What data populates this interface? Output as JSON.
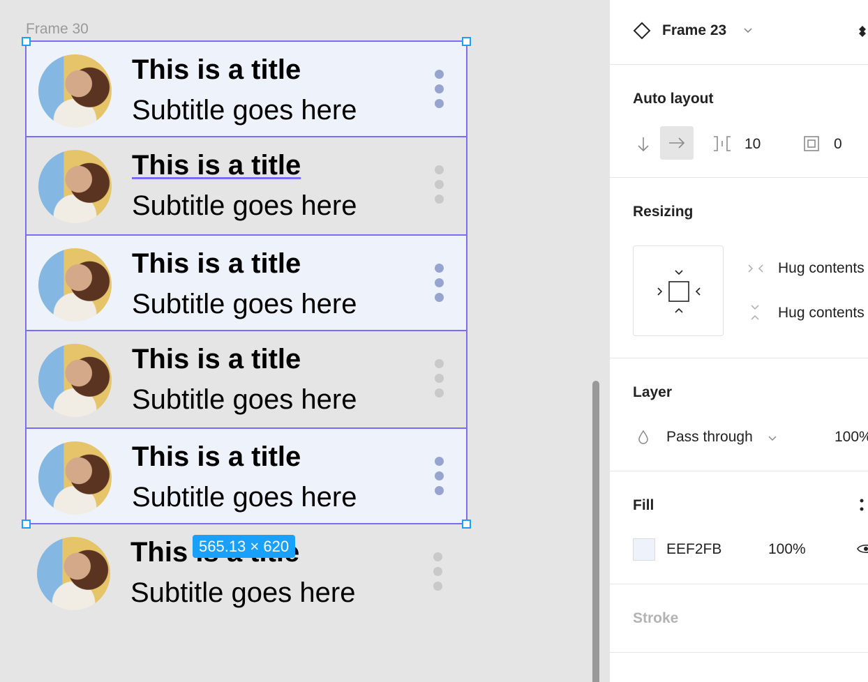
{
  "canvas": {
    "frame_label": "Frame 30",
    "size_badge": "565.13 × 620",
    "rows": [
      {
        "title": "This is a title",
        "subtitle": "Subtitle goes here"
      },
      {
        "title": "This is a title",
        "subtitle": "Subtitle goes here"
      },
      {
        "title": "This is a title",
        "subtitle": "Subtitle goes here"
      },
      {
        "title": "This is a title",
        "subtitle": "Subtitle goes here"
      },
      {
        "title": "This is a title",
        "subtitle": "Subtitle goes here"
      },
      {
        "title": "This is a title",
        "subtitle": "Subtitle goes here"
      }
    ]
  },
  "panel": {
    "header": {
      "frame_name": "Frame 23"
    },
    "auto_layout": {
      "title": "Auto layout",
      "spacing": "10",
      "padding": "0"
    },
    "resizing": {
      "title": "Resizing",
      "horizontal": "Hug contents",
      "vertical": "Hug contents"
    },
    "layer": {
      "title": "Layer",
      "blend_mode": "Pass through",
      "opacity": "100%"
    },
    "fill": {
      "title": "Fill",
      "hex": "EEF2FB",
      "opacity": "100%",
      "swatch_color": "#EEF2FB"
    },
    "stroke": {
      "title": "Stroke"
    }
  },
  "colors": {
    "selection": "#7B6CF6",
    "handle": "#18A0FB",
    "highlight_bg": "#EEF2FB"
  }
}
